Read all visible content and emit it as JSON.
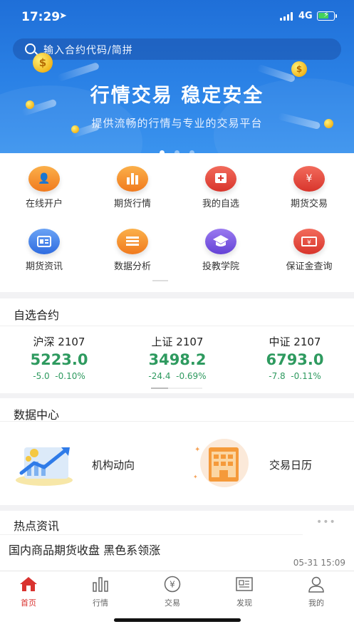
{
  "status_bar": {
    "time": "17:29",
    "network": "4G"
  },
  "search": {
    "placeholder": "输入合约代码/简拼"
  },
  "banner": {
    "title": "行情交易  稳定安全",
    "subtitle": "提供流畅的行情与专业的交易平台",
    "page_count": 3,
    "active_page": 1
  },
  "quick_menu": [
    {
      "label": "在线开户",
      "icon": "open-account-icon",
      "color": "#f58a2b"
    },
    {
      "label": "期货行情",
      "icon": "bar-chart-icon",
      "color": "#f58a2b"
    },
    {
      "label": "我的自选",
      "icon": "add-favorite-icon",
      "color": "#e0463b"
    },
    {
      "label": "期货交易",
      "icon": "yen-wallet-icon",
      "color": "#e0463b"
    },
    {
      "label": "期货资讯",
      "icon": "news-card-icon",
      "color": "#3f7ee6"
    },
    {
      "label": "数据分析",
      "icon": "list-icon",
      "color": "#f58a2b"
    },
    {
      "label": "投教学院",
      "icon": "graduation-cap-icon",
      "color": "#7554e0"
    },
    {
      "label": "保证金查询",
      "icon": "ticket-icon",
      "color": "#e0463b"
    }
  ],
  "watchlist": {
    "title": "自选合约",
    "items": [
      {
        "name": "沪深 2107",
        "price": "5223.0",
        "change": "-5.0",
        "change_pct": "-0.10%"
      },
      {
        "name": "上证 2107",
        "price": "3498.2",
        "change": "-24.4",
        "change_pct": "-0.69%"
      },
      {
        "name": "中证 2107",
        "price": "6793.0",
        "change": "-7.8",
        "change_pct": "-0.11%"
      }
    ],
    "down_color": "#2e9a5f"
  },
  "data_center": {
    "title": "数据中心",
    "items": [
      {
        "label": "机构动向",
        "icon": "trend-chart-illustration"
      },
      {
        "label": "交易日历",
        "icon": "calendar-building-illustration"
      }
    ]
  },
  "news": {
    "title": "热点资讯",
    "more": "•••",
    "headline": "国内商品期货收盘 黑色系领涨",
    "time": "05-31 15:09"
  },
  "tabbar": {
    "active_color": "#d9322f",
    "tabs": [
      {
        "label": "首页",
        "icon": "home-icon",
        "active": true
      },
      {
        "label": "行情",
        "icon": "bar-chart-icon",
        "active": false
      },
      {
        "label": "交易",
        "icon": "yen-coin-icon",
        "active": false
      },
      {
        "label": "发现",
        "icon": "newspaper-icon",
        "active": false
      },
      {
        "label": "我的",
        "icon": "user-icon",
        "active": false
      }
    ]
  }
}
